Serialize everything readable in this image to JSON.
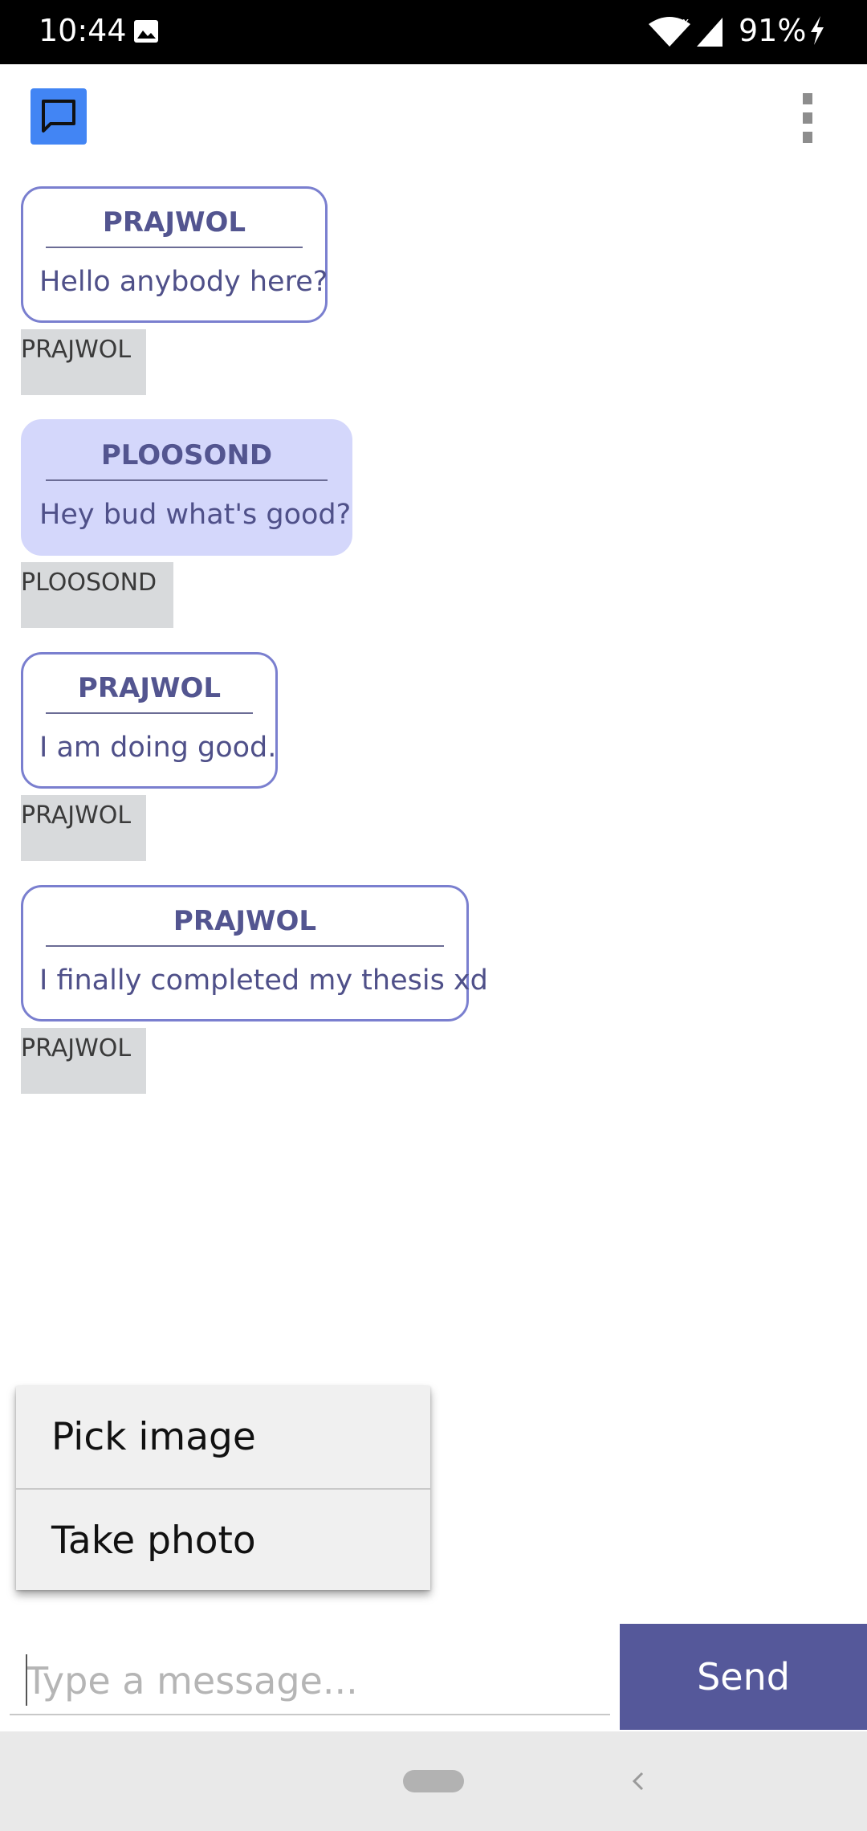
{
  "status_bar": {
    "time": "10:44",
    "battery": "91%",
    "icons": [
      "gallery-icon",
      "wifi-icon",
      "signal-icon",
      "charging-icon"
    ]
  },
  "app_bar": {
    "logo_icon": "chat-icon",
    "menu_icon": "overflow-menu-icon",
    "logo_color": "#4285f4"
  },
  "messages": [
    {
      "name": "PRAJWOL",
      "text": "Hello anybody here?",
      "sender": "PRAJWOL",
      "style": "outline"
    },
    {
      "name": "PLOOSOND",
      "text": "Hey bud what's good?",
      "sender": "PLOOSOND",
      "style": "filled"
    },
    {
      "name": "PRAJWOL",
      "text": "I am doing good.",
      "sender": "PRAJWOL",
      "style": "outline"
    },
    {
      "name": "PRAJWOL",
      "text": "I finally completed my thesis xd",
      "sender": "PRAJWOL",
      "style": "outline"
    }
  ],
  "popup_menu": {
    "items": [
      "Pick image",
      "Take photo"
    ]
  },
  "composer": {
    "placeholder": "Type a message...",
    "value": "",
    "send_label": "Send",
    "send_color": "#55589a"
  },
  "colors": {
    "bubble_border": "#7a7fcf",
    "bubble_fill": "#d4d7fb",
    "name_text": "#535590",
    "sender_tag_bg": "#d8dadc"
  }
}
